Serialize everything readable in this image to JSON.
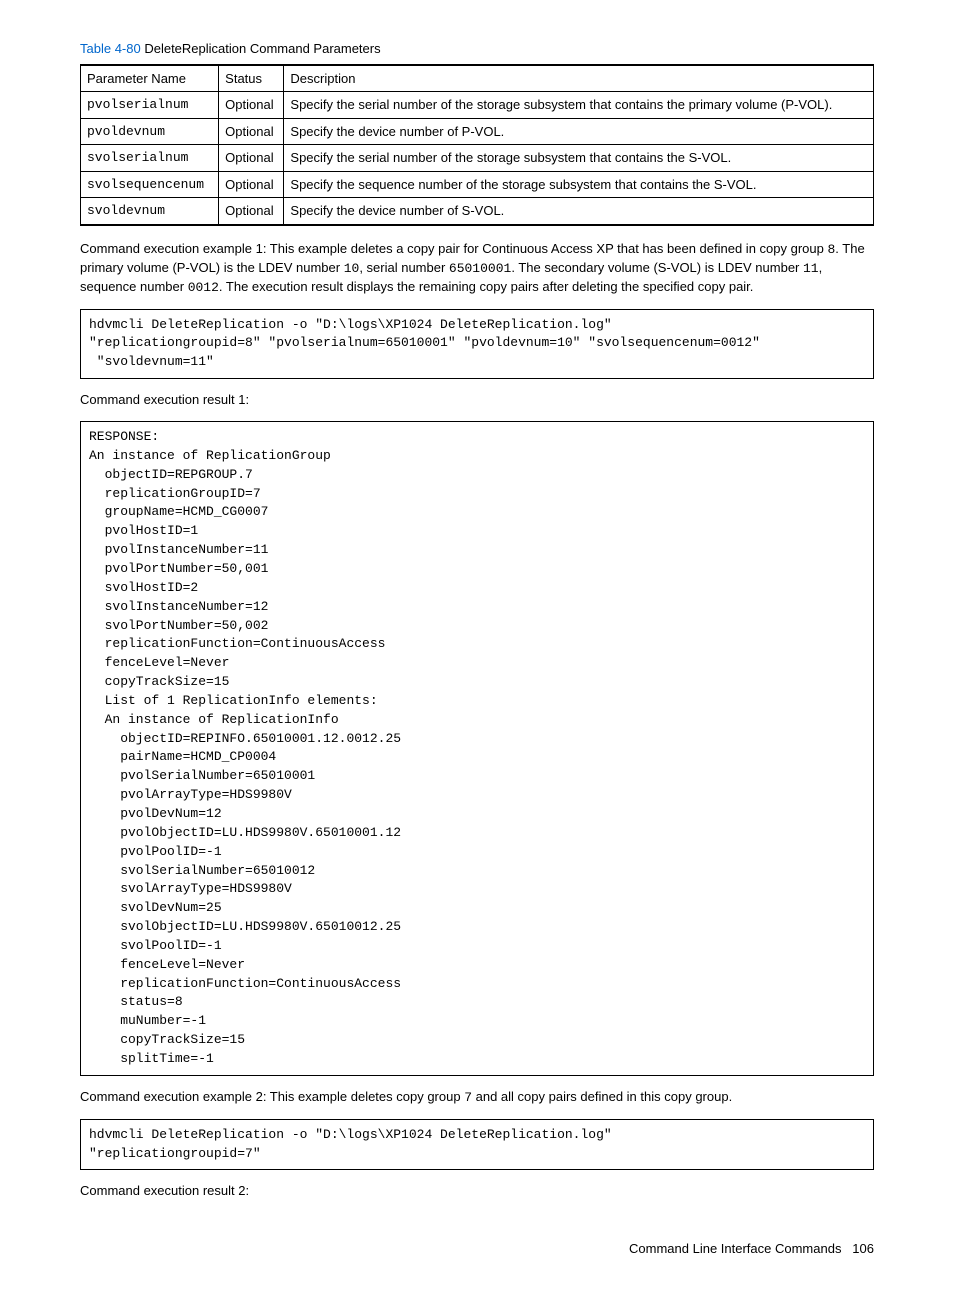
{
  "table": {
    "caption_num": "Table 4-80",
    "caption_text": "  DeleteReplication Command Parameters",
    "headers": {
      "c1": "Parameter Name",
      "c2": "Status",
      "c3": "Description"
    },
    "rows": [
      {
        "param": "pvolserialnum",
        "status": "Optional",
        "desc": "Specify the serial number of the storage subsystem that contains the primary volume (P-VOL)."
      },
      {
        "param": "pvoldevnum",
        "status": "Optional",
        "desc": "Specify the device number of P-VOL."
      },
      {
        "param": "svolserialnum",
        "status": "Optional",
        "desc": "Specify the serial number of the storage subsystem that contains the S-VOL."
      },
      {
        "param": "svolsequencenum",
        "status": "Optional",
        "desc": "Specify the sequence number of the storage subsystem that contains the S-VOL."
      },
      {
        "param": "svoldevnum",
        "status": "Optional",
        "desc": "Specify the device number of S-VOL."
      }
    ]
  },
  "para1": {
    "t1": "Command execution example 1: This example deletes a copy pair for Continuous Access XP that has been defined in copy group ",
    "m1": "8",
    "t2": ". The primary volume (P-VOL) is the LDEV number ",
    "m2": "10",
    "t3": ", serial number ",
    "m3": "65010001",
    "t4": ". The secondary volume (S-VOL) is LDEV number ",
    "m4": "11",
    "t5": ", sequence number ",
    "m5": "0012",
    "t6": ". The execution result displays the remaining copy pairs after deleting the specified copy pair."
  },
  "code1": "hdvmcli DeleteReplication -o \"D:\\logs\\XP1024 DeleteReplication.log\"\n\"replicationgroupid=8\" \"pvolserialnum=65010001\" \"pvoldevnum=10\" \"svolsequencenum=0012\"\n \"svoldevnum=11\"",
  "result1_label": "Command execution result 1:",
  "code2": "RESPONSE:\nAn instance of ReplicationGroup\n  objectID=REPGROUP.7\n  replicationGroupID=7\n  groupName=HCMD_CG0007\n  pvolHostID=1\n  pvolInstanceNumber=11\n  pvolPortNumber=50,001\n  svolHostID=2\n  svolInstanceNumber=12\n  svolPortNumber=50,002\n  replicationFunction=ContinuousAccess\n  fenceLevel=Never\n  copyTrackSize=15\n  List of 1 ReplicationInfo elements:\n  An instance of ReplicationInfo\n    objectID=REPINFO.65010001.12.0012.25\n    pairName=HCMD_CP0004\n    pvolSerialNumber=65010001\n    pvolArrayType=HDS9980V\n    pvolDevNum=12\n    pvolObjectID=LU.HDS9980V.65010001.12\n    pvolPoolID=-1\n    svolSerialNumber=65010012\n    svolArrayType=HDS9980V\n    svolDevNum=25\n    svolObjectID=LU.HDS9980V.65010012.25\n    svolPoolID=-1\n    fenceLevel=Never\n    replicationFunction=ContinuousAccess\n    status=8\n    muNumber=-1\n    copyTrackSize=15\n    splitTime=-1",
  "para2": {
    "t1": "Command execution example 2: This example deletes copy group ",
    "m1": "7",
    "t2": " and all copy pairs defined in this copy group."
  },
  "code3": "hdvmcli DeleteReplication -o \"D:\\logs\\XP1024 DeleteReplication.log\"\n\"replicationgroupid=7\"",
  "result2_label": "Command execution result 2:",
  "footer": {
    "title": "Command Line Interface Commands",
    "page": "106"
  }
}
